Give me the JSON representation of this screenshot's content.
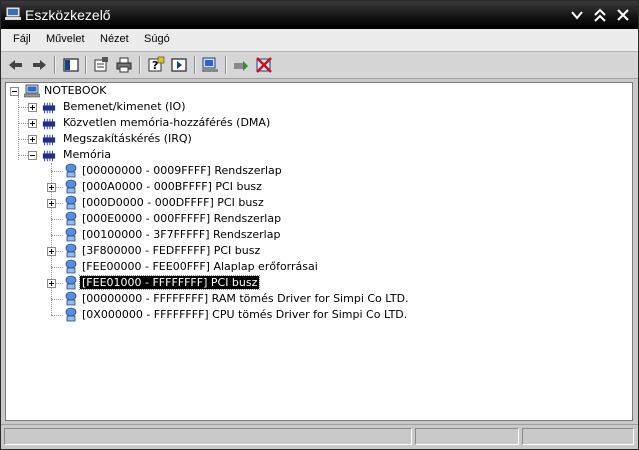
{
  "window": {
    "title": "Eszközkezelő",
    "colors": {
      "titlebar": "#000000",
      "title_text": "#ffffff",
      "selection": "#000000"
    }
  },
  "menu": [
    {
      "label": "Fájl"
    },
    {
      "label": "Művelet"
    },
    {
      "label": "Nézet"
    },
    {
      "label": "Súgó"
    }
  ],
  "toolbar": {
    "buttons": [
      {
        "icon": "back-arrow-icon"
      },
      {
        "icon": "forward-arrow-icon"
      },
      {
        "icon": "show-hide-console-tree-icon"
      },
      {
        "icon": "properties-icon"
      },
      {
        "icon": "print-icon"
      },
      {
        "icon": "help-icon"
      },
      {
        "icon": "show-action-pane-icon"
      },
      {
        "icon": "scan-hardware-icon"
      },
      {
        "icon": "update-driver-icon"
      },
      {
        "icon": "uninstall-icon"
      }
    ]
  },
  "tree": {
    "root": {
      "label": "NOTEBOOK",
      "icon": "computer-icon"
    },
    "categories": [
      {
        "label": "Bemenet/kimenet (IO)",
        "icon": "chip-icon",
        "expanded": false
      },
      {
        "label": "Közvetlen memória-hozzáférés (DMA)",
        "icon": "chip-icon",
        "expanded": false
      },
      {
        "label": "Megszakításkérés (IRQ)",
        "icon": "chip-icon",
        "expanded": false
      },
      {
        "label": "Memória",
        "icon": "chip-icon",
        "expanded": true
      }
    ],
    "memory_items": [
      {
        "label": "[00000000 - 0009FFFF]  Rendszerlap",
        "expandable": false,
        "selected": false
      },
      {
        "label": "[000A0000 - 000BFFFF]  PCI busz",
        "expandable": true,
        "selected": false
      },
      {
        "label": "[000D0000 - 000DFFFF]  PCI busz",
        "expandable": true,
        "selected": false
      },
      {
        "label": "[000E0000 - 000FFFFF]  Rendszerlap",
        "expandable": false,
        "selected": false
      },
      {
        "label": "[00100000 - 3F7FFFFF]  Rendszerlap",
        "expandable": false,
        "selected": false
      },
      {
        "label": "[3F800000 - FEDFFFFF]  PCI busz",
        "expandable": true,
        "selected": false
      },
      {
        "label": "[FEE00000 - FEE00FFF]  Alaplap erőforrásai",
        "expandable": false,
        "selected": false
      },
      {
        "label": "[FEE01000 - FFFFFFFF]  PCI busz",
        "expandable": true,
        "selected": true
      },
      {
        "label": "[00000000 - FFFFFFFF] RAM tömés Driver for Simpi Co LTD.",
        "expandable": false,
        "selected": false
      },
      {
        "label": "[0X000000 - FFFFFFFF] CPU tömés Driver for Simpi Co LTD.",
        "expandable": false,
        "selected": false
      }
    ]
  }
}
